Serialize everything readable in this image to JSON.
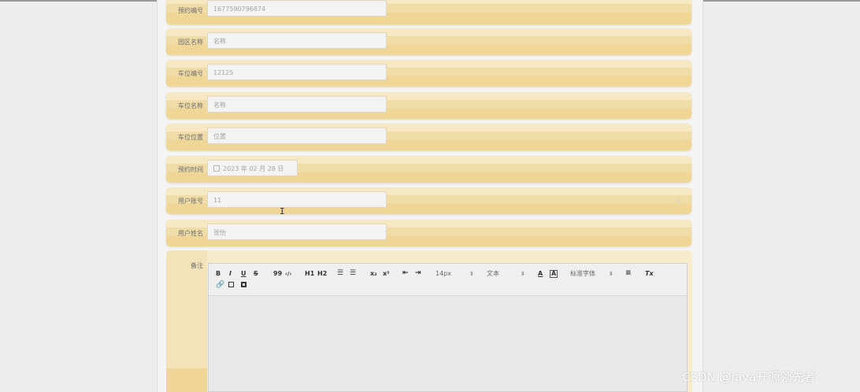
{
  "form": {
    "fields": [
      {
        "label": "预约编号",
        "value": "1677590796874"
      },
      {
        "label": "园区名称",
        "value": "名称"
      },
      {
        "label": "车位编号",
        "value": "12125"
      },
      {
        "label": "车位名称",
        "value": "名称"
      },
      {
        "label": "车位位置",
        "value": "位置"
      },
      {
        "label": "预约时间",
        "value": "2023 年 02 月 28 日"
      },
      {
        "label": "用户账号",
        "value": "11"
      },
      {
        "label": "用户姓名",
        "value": "张怡"
      }
    ],
    "remark_label": "备注"
  },
  "editor": {
    "toolbar": {
      "bold": "B",
      "italic": "I",
      "underline": "U",
      "strike": "S",
      "quote": "99",
      "code": "‹/›",
      "h1": "H1",
      "h2": "H2",
      "subscript": "x₂",
      "superscript": "x²",
      "font_size": "14px",
      "text_type": "文本",
      "font_family": "标准字体",
      "color": "A",
      "background": "A",
      "clear": "Tx"
    }
  },
  "watermark": "CSDN @Java开源领先者"
}
